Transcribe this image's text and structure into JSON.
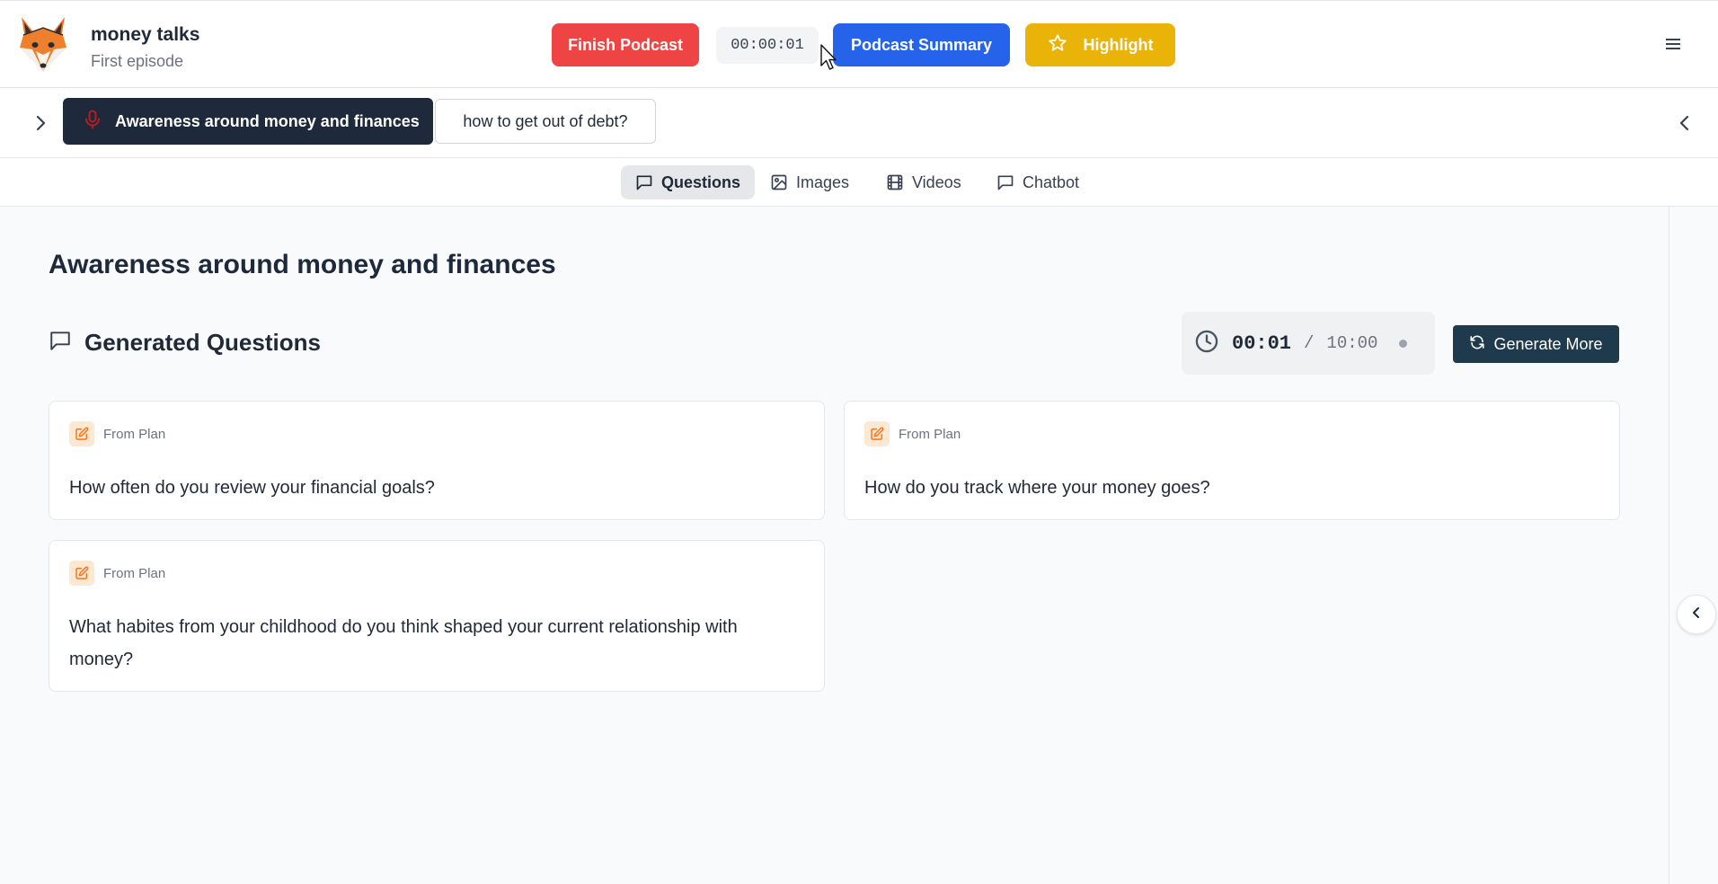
{
  "header": {
    "title": "money talks",
    "subtitle": "First episode",
    "finish_label": "Finish Podcast",
    "elapsed": "00:00:01",
    "summary_label": "Podcast Summary",
    "highlight_label": "Highlight"
  },
  "topics": [
    {
      "label": "Awareness around money and finances",
      "active": true
    },
    {
      "label": "how to get out of debt?",
      "active": false
    }
  ],
  "tabs": [
    {
      "label": "Questions",
      "icon": "message-square-icon",
      "active": true
    },
    {
      "label": "Images",
      "icon": "image-icon",
      "active": false
    },
    {
      "label": "Videos",
      "icon": "film-icon",
      "active": false
    },
    {
      "label": "Chatbot",
      "icon": "message-square-icon",
      "active": false
    }
  ],
  "main": {
    "title": "Awareness around money and finances",
    "section_title": "Generated Questions",
    "timer": {
      "current": "00:01",
      "separator": "/",
      "total": "10:00"
    },
    "generate_label": "Generate More"
  },
  "questions": [
    {
      "source": "From Plan",
      "text": "How often do you review your financial goals?"
    },
    {
      "source": "From Plan",
      "text": "How do you track where your money goes?"
    },
    {
      "source": "From Plan",
      "text": "What habites from your childhood do you think shaped your current relationship with money?"
    }
  ],
  "colors": {
    "finish": "#ef4444",
    "summary": "#2563eb",
    "highlight": "#eab308",
    "active_topic": "#1e293b",
    "generate": "#1e3a4c",
    "tag_bg": "#fde8d4",
    "tag_fg": "#f97316"
  }
}
